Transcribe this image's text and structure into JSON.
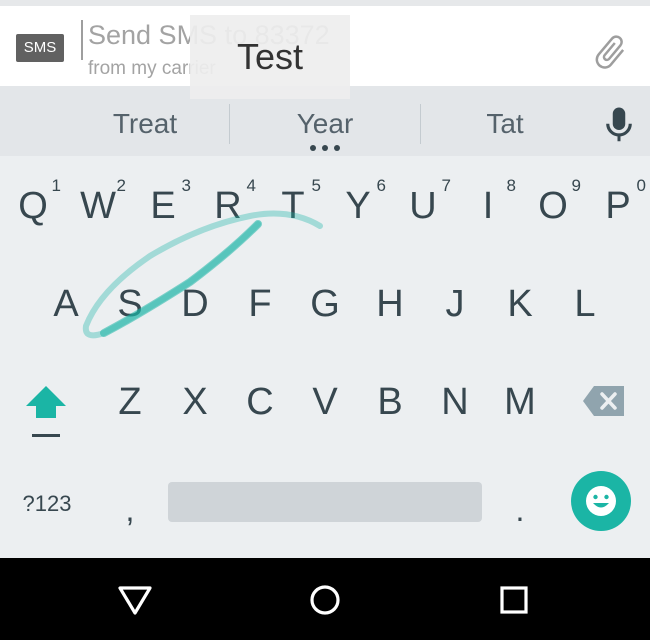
{
  "compose": {
    "badge": "SMS",
    "hint_line1": "Send SMS to 83372",
    "hint_line2": "from my carrier",
    "attach_icon": "paperclip-icon"
  },
  "gesture_preview": "Test",
  "suggestions": [
    "Treat",
    "Year",
    "Tat"
  ],
  "keyboard": {
    "row1": [
      {
        "k": "Q",
        "n": "1"
      },
      {
        "k": "W",
        "n": "2"
      },
      {
        "k": "E",
        "n": "3"
      },
      {
        "k": "R",
        "n": "4"
      },
      {
        "k": "T",
        "n": "5"
      },
      {
        "k": "Y",
        "n": "6"
      },
      {
        "k": "U",
        "n": "7"
      },
      {
        "k": "I",
        "n": "8"
      },
      {
        "k": "O",
        "n": "9"
      },
      {
        "k": "P",
        "n": "0"
      }
    ],
    "row2": [
      "A",
      "S",
      "D",
      "F",
      "G",
      "H",
      "J",
      "K",
      "L"
    ],
    "row3": [
      "Z",
      "X",
      "C",
      "V",
      "B",
      "N",
      "M"
    ],
    "sym_label": "?123",
    "comma": ",",
    "period": ".",
    "accent_color": "#1bb5a5"
  },
  "nav": {
    "back_icon": "back-triangle-icon",
    "home_icon": "home-circle-icon",
    "recents_icon": "recents-square-icon"
  }
}
